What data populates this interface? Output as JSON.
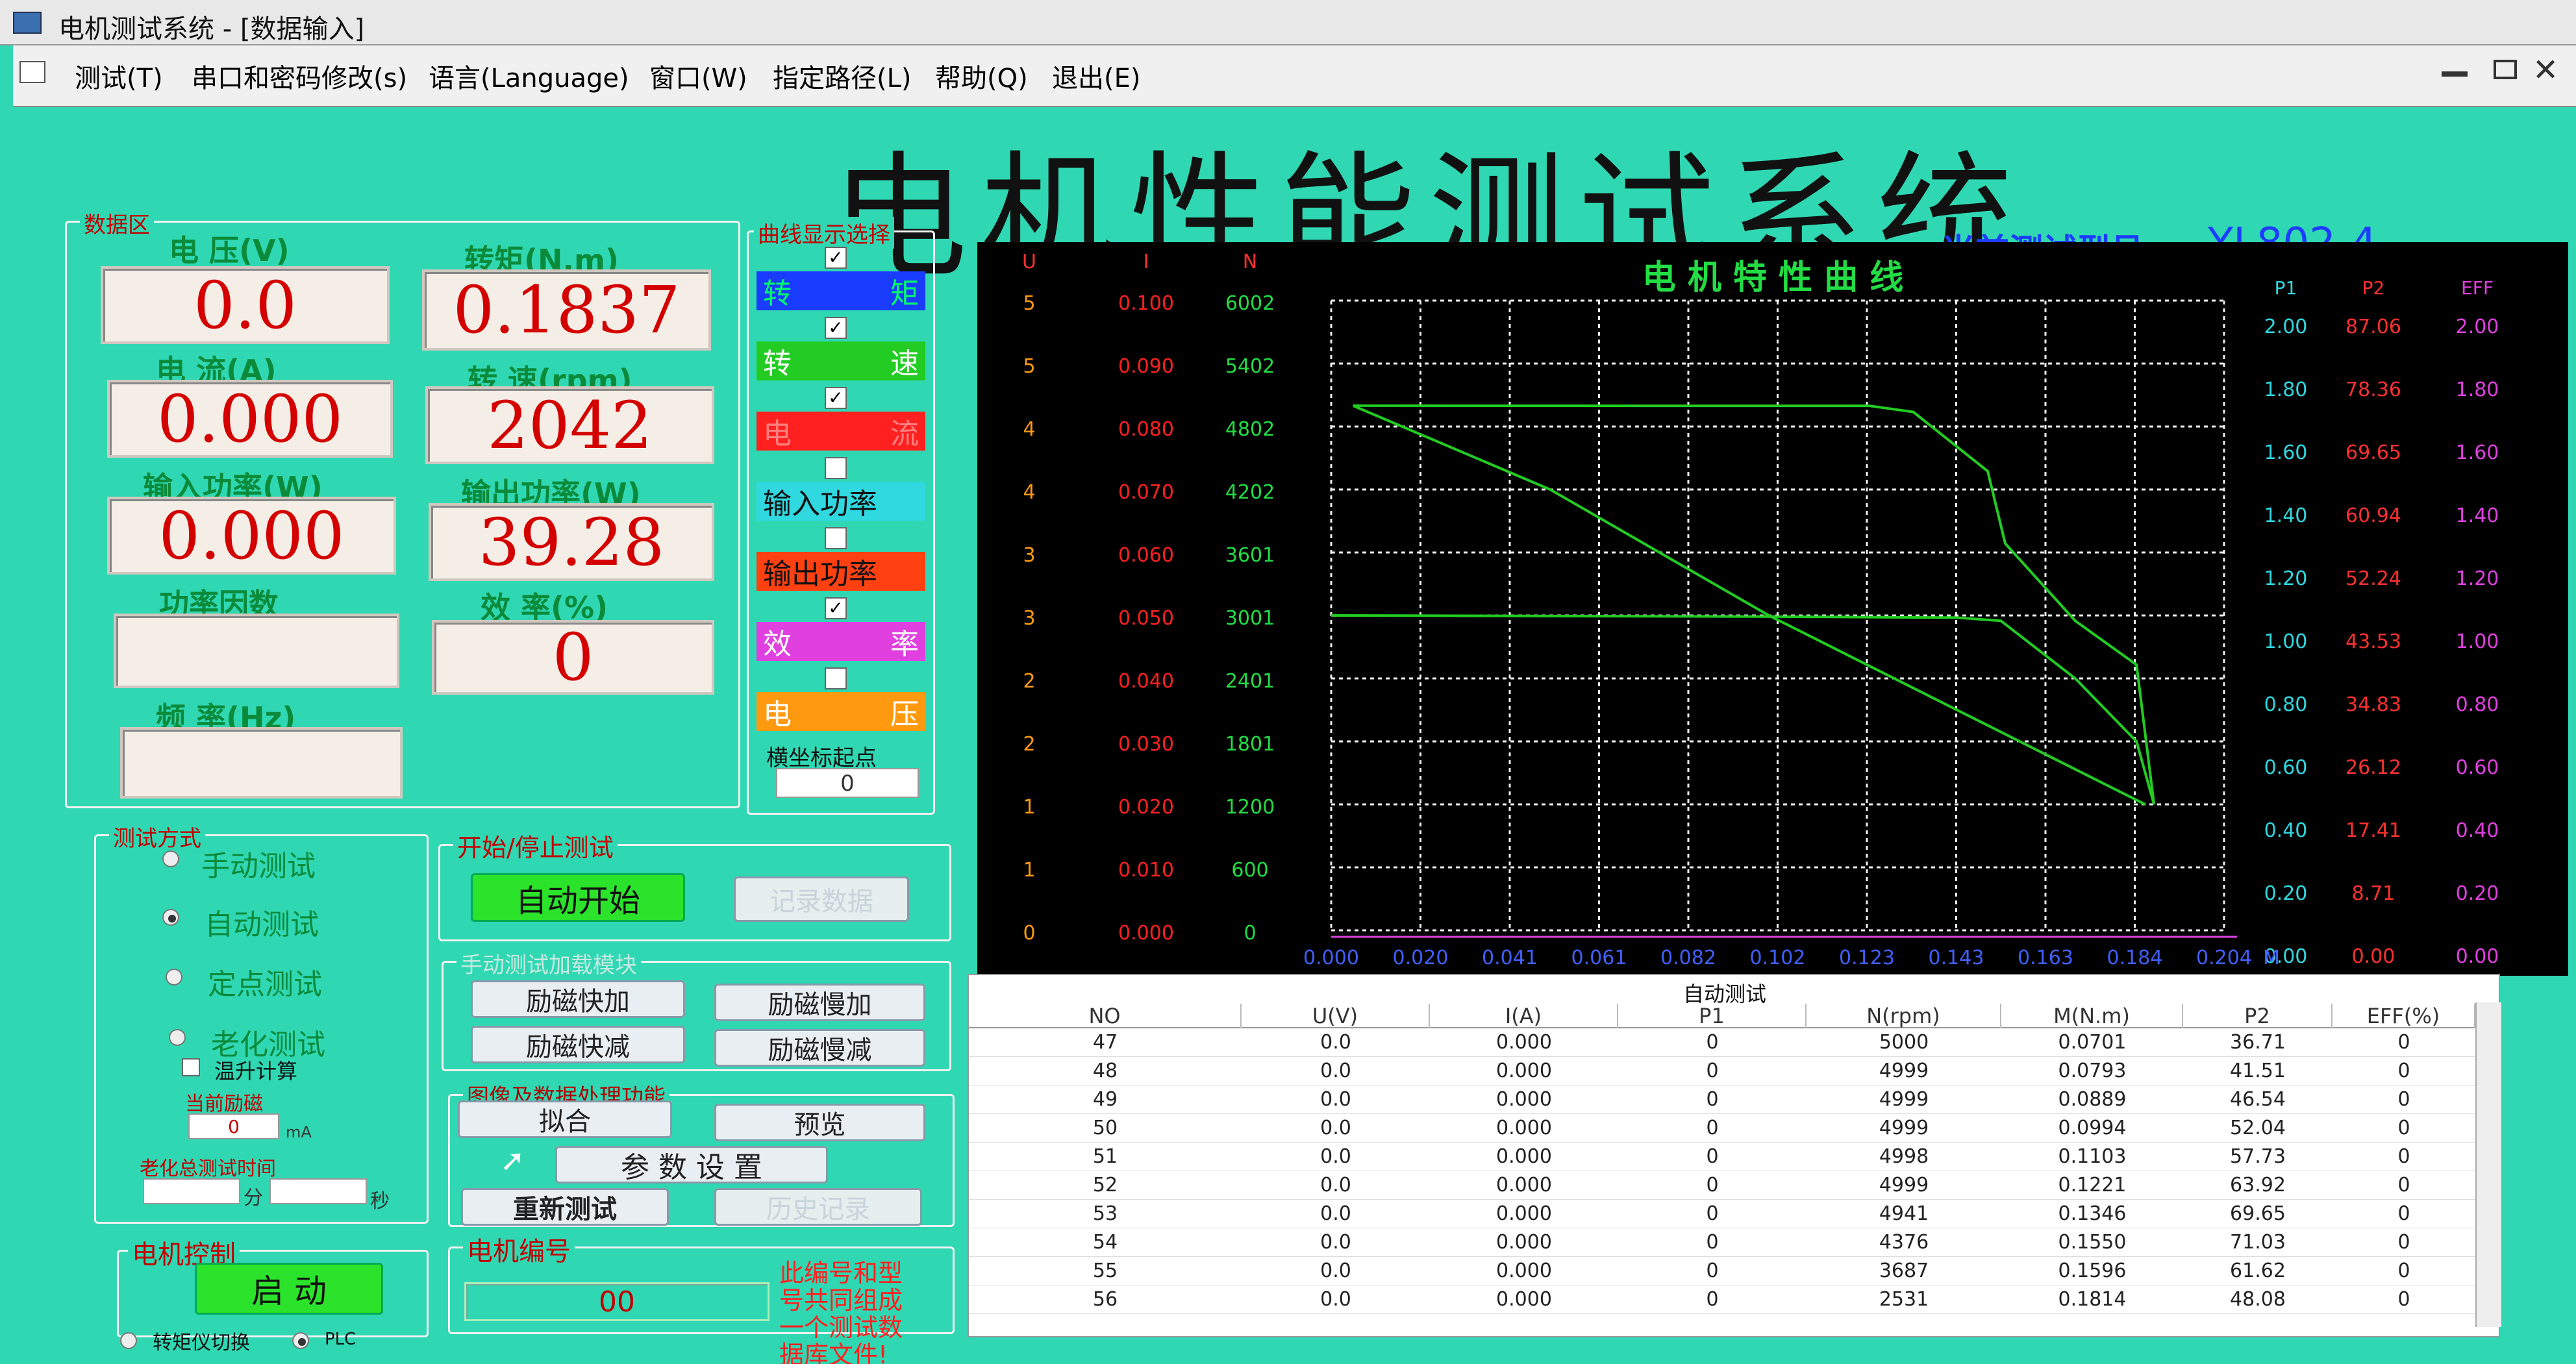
{
  "window": {
    "title": "电机测试系统 - [数据输入]",
    "menu": [
      "测试(T)",
      "串口和密码修改(s)",
      "语言(Language)",
      "窗口(W)",
      "指定路径(L)",
      "帮助(Q)",
      "退出(E)"
    ]
  },
  "header": {
    "title": "电机性能测试系统",
    "model_label": "当前测试型号",
    "model_value": "YL802-4"
  },
  "data_area": {
    "title": "数据区",
    "fields": [
      {
        "label": "电 压(V)",
        "value": "0.0"
      },
      {
        "label": "转矩(N.m)",
        "value": "0.1837"
      },
      {
        "label": "电 流(A)",
        "value": "0.000"
      },
      {
        "label": "转 速(rpm)",
        "value": "2042"
      },
      {
        "label": "输入功率(W)",
        "value": "0.000"
      },
      {
        "label": "输出功率(W)",
        "value": "39.28"
      },
      {
        "label": "功率因数",
        "value": ""
      },
      {
        "label": "效 率(%)",
        "value": "0"
      },
      {
        "label": "频 率(Hz)",
        "value": ""
      }
    ]
  },
  "curve_select": {
    "title": "曲线显示选择",
    "items": [
      {
        "label": "转矩",
        "checked": true,
        "color": "#1a3cff",
        "text_color": "#00ff66"
      },
      {
        "label": "转速",
        "checked": true,
        "color": "#22cc22",
        "text_color": "#ffffff"
      },
      {
        "label": "电流",
        "checked": true,
        "color": "#ff2020",
        "text_color": "#ff8080"
      },
      {
        "label": "输入功率",
        "checked": false,
        "color": "#30d8e0",
        "text_color": "#111111"
      },
      {
        "label": "输出功率",
        "checked": false,
        "color": "#ff4010",
        "text_color": "#111111"
      },
      {
        "label": "效率",
        "checked": true,
        "color": "#e040e0",
        "text_color": "#ffffff"
      },
      {
        "label": "电压",
        "checked": false,
        "color": "#ff9a10",
        "text_color": "#ffffff"
      }
    ],
    "origin_label": "横坐标起点",
    "origin_value": "0"
  },
  "test_mode": {
    "title": "测试方式",
    "options": [
      "手动测试",
      "自动测试",
      "定点测试",
      "老化测试"
    ],
    "selected": 1,
    "temp_rise": "温升计算",
    "excitation_label": "当前励磁",
    "excitation_value": "0",
    "excitation_unit": "mA",
    "aging_time_label": "老化总测试时间",
    "minute_unit": "分",
    "second_unit": "秒"
  },
  "start_stop": {
    "title": "开始/停止测试",
    "auto_start": "自动开始",
    "record": "记录数据"
  },
  "manual_load": {
    "title": "手动测试加载模块",
    "buttons": [
      "励磁快加",
      "励磁慢加",
      "励磁快减",
      "励磁慢减"
    ]
  },
  "image_proc": {
    "title": "图像及数据处理功能",
    "fit": "拟合",
    "preview": "预览",
    "params": "参 数 设 置",
    "retest": "重新测试",
    "history": "历史记录"
  },
  "motor_control": {
    "title": "电机控制",
    "start": "启 动",
    "torque_switch": "转矩仪切换",
    "plc": "PLC"
  },
  "motor_number": {
    "title": "电机编号",
    "value": "00",
    "note": "此编号和型号共同组成一个测试数据库文件!"
  },
  "chart_data": {
    "type": "line",
    "title": "电 机 特 性 曲 线",
    "left_axes": {
      "headers": [
        "U",
        "I",
        "N"
      ],
      "U": [
        "5",
        "5",
        "4",
        "4",
        "3",
        "3",
        "2",
        "2",
        "1",
        "1",
        "0"
      ],
      "I": [
        "0.100",
        "0.090",
        "0.080",
        "0.070",
        "0.060",
        "0.050",
        "0.040",
        "0.030",
        "0.020",
        "0.010",
        "0.000"
      ],
      "N": [
        "6002",
        "5402",
        "4802",
        "4202",
        "3601",
        "3001",
        "2401",
        "1801",
        "1200",
        "600",
        "0"
      ]
    },
    "right_axes": {
      "headers": [
        "P1",
        "P2",
        "EFF"
      ],
      "P1": [
        "2.00",
        "1.80",
        "1.60",
        "1.40",
        "1.20",
        "1.00",
        "0.80",
        "0.60",
        "0.40",
        "0.20",
        "0.00"
      ],
      "P2": [
        "87.06",
        "78.36",
        "69.65",
        "60.94",
        "52.24",
        "43.53",
        "34.83",
        "26.12",
        "17.41",
        "8.71",
        "0.00"
      ],
      "EFF": [
        "2.00",
        "1.80",
        "1.60",
        "1.40",
        "1.20",
        "1.00",
        "0.80",
        "0.60",
        "0.40",
        "0.20",
        "0.00"
      ]
    },
    "x_ticks": [
      "0.000",
      "0.020",
      "0.041",
      "0.061",
      "0.082",
      "0.102",
      "0.123",
      "0.143",
      "0.163",
      "0.184",
      "0.204"
    ],
    "x_unit": "M",
    "xlim": [
      0,
      0.204
    ],
    "series": [
      {
        "color": "#22cc22",
        "x": [
          0.005,
          0.07,
          0.123,
          0.133,
          0.15,
          0.154,
          0.17,
          0.184,
          0.188
        ],
        "y_rpm": [
          5000,
          4999,
          4999,
          4941,
          4376,
          3687,
          2950,
          2531,
          1200
        ]
      },
      {
        "color": "#22cc22",
        "x": [
          0.0,
          0.1,
          0.143,
          0.153,
          0.17,
          0.184,
          0.188
        ],
        "y_rpm": [
          3001,
          2990,
          2980,
          2950,
          2401,
          1800,
          1200
        ]
      },
      {
        "color": "#22cc22",
        "x": [
          0.005,
          0.05,
          0.1,
          0.143,
          0.186
        ],
        "y_rpm": [
          5000,
          4202,
          3001,
          2100,
          1200
        ]
      }
    ]
  },
  "table": {
    "caption": "自动测试",
    "columns": [
      "NO",
      "U(V)",
      "I(A)",
      "P1",
      "N(rpm)",
      "M(N.m)",
      "P2",
      "EFF(%)"
    ],
    "rows": [
      [
        "47",
        "0.0",
        "0.000",
        "0",
        "5000",
        "0.0701",
        "36.71",
        "0"
      ],
      [
        "48",
        "0.0",
        "0.000",
        "0",
        "4999",
        "0.0793",
        "41.51",
        "0"
      ],
      [
        "49",
        "0.0",
        "0.000",
        "0",
        "4999",
        "0.0889",
        "46.54",
        "0"
      ],
      [
        "50",
        "0.0",
        "0.000",
        "0",
        "4999",
        "0.0994",
        "52.04",
        "0"
      ],
      [
        "51",
        "0.0",
        "0.000",
        "0",
        "4998",
        "0.1103",
        "57.73",
        "0"
      ],
      [
        "52",
        "0.0",
        "0.000",
        "0",
        "4999",
        "0.1221",
        "63.92",
        "0"
      ],
      [
        "53",
        "0.0",
        "0.000",
        "0",
        "4941",
        "0.1346",
        "69.65",
        "0"
      ],
      [
        "54",
        "0.0",
        "0.000",
        "0",
        "4376",
        "0.1550",
        "71.03",
        "0"
      ],
      [
        "55",
        "0.0",
        "0.000",
        "0",
        "3687",
        "0.1596",
        "61.62",
        "0"
      ],
      [
        "56",
        "0.0",
        "0.000",
        "0",
        "2531",
        "0.1814",
        "48.08",
        "0"
      ]
    ]
  }
}
